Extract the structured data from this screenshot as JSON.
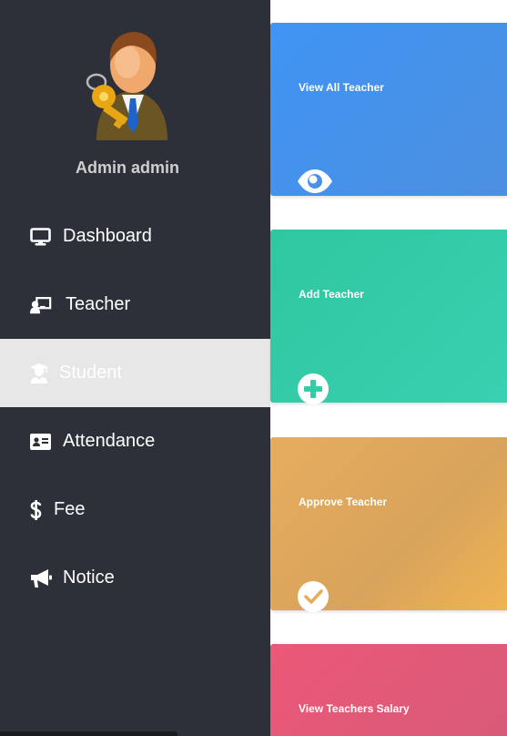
{
  "sidebar": {
    "user_name": "Admin admin",
    "items": [
      {
        "label": "Dashboard",
        "icon": "monitor-icon"
      },
      {
        "label": "Teacher",
        "icon": "chalkboard-teacher-icon"
      },
      {
        "label": "Student",
        "icon": "graduate-icon",
        "active": true
      },
      {
        "label": "Attendance",
        "icon": "id-card-icon"
      },
      {
        "label": "Fee",
        "icon": "dollar-icon"
      },
      {
        "label": "Notice",
        "icon": "megaphone-icon"
      }
    ]
  },
  "cards": [
    {
      "title": "View All Teacher",
      "icon": "eye-icon",
      "color": "#3f94f4"
    },
    {
      "title": "Add Teacher",
      "icon": "plus-circle-icon",
      "color": "#2fc7a0"
    },
    {
      "title": "Approve Teacher",
      "icon": "check-circle-icon",
      "color": "#e7ad5e"
    },
    {
      "title": "View Teachers Salary",
      "icon": "money-icon",
      "color": "#ec5878"
    }
  ]
}
